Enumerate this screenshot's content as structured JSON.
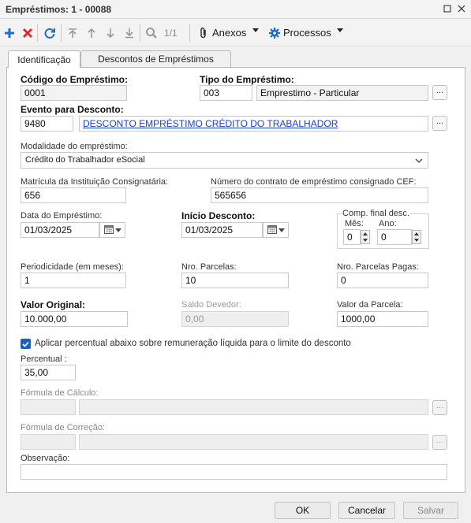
{
  "window": {
    "title": "Empréstimos: 1 - 00088"
  },
  "toolbar": {
    "pager": "1/1",
    "attachments_label": "Anexos",
    "processes_label": "Processos"
  },
  "tabs": [
    {
      "label": "Identificação",
      "active": true
    },
    {
      "label": "Descontos de Empréstimos",
      "active": false
    }
  ],
  "form": {
    "codigo": {
      "label": "Código do Empréstimo:",
      "value": "0001"
    },
    "tipo": {
      "label": "Tipo do Empréstimo:",
      "code": "003",
      "desc": "Emprestimo - Particular"
    },
    "evento": {
      "label": "Evento para Desconto:",
      "code": "9480",
      "desc": "DESCONTO EMPRÉSTIMO CRÉDITO DO TRABALHADOR"
    },
    "modalidade": {
      "label": "Modalidade do empréstimo:",
      "value": "Crédito do Trabalhador eSocial"
    },
    "matricula": {
      "label": "Matrícula da Instituição Consignatária:",
      "value": "656"
    },
    "contrato": {
      "label": "Número do contrato de empréstimo consignado CEF:",
      "value": "565656"
    },
    "data_emprestimo": {
      "label": "Data do Empréstimo:",
      "value": "01/03/2025"
    },
    "inicio_desconto": {
      "label": "Início Desconto:",
      "value": "01/03/2025"
    },
    "comp_final": {
      "label": "Comp. final desc.",
      "mes_label": "Mês:",
      "mes_value": "0",
      "ano_label": "Ano:",
      "ano_value": "0"
    },
    "periodicidade": {
      "label": "Periodicidade (em meses):",
      "value": "1"
    },
    "nro_parcelas": {
      "label": "Nro. Parcelas:",
      "value": "10"
    },
    "parcelas_pagas": {
      "label": "Nro. Parcelas Pagas:",
      "value": "0"
    },
    "valor_original": {
      "label": "Valor Original:",
      "value": "10.000,00"
    },
    "saldo_devedor": {
      "label": "Saldo Devedor:",
      "value": "0,00"
    },
    "valor_parcela": {
      "label": "Valor da Parcela:",
      "value": "1000,00"
    },
    "aplicar_percentual": {
      "label": "Aplicar percentual abaixo sobre remuneração líquida para o limite do desconto",
      "checked": true
    },
    "percentual": {
      "label": "Percentual :",
      "value": "35,00"
    },
    "formula_calculo": {
      "label": "Fórmula de Cálculo:",
      "value": ""
    },
    "formula_correcao": {
      "label": "Fórmula de Correção:",
      "value": ""
    },
    "observacao": {
      "label": "Observação:",
      "value": ""
    },
    "lookup_button": "..."
  },
  "footer": {
    "ok": "OK",
    "cancel": "Cancelar",
    "save": "Salvar"
  },
  "colors": {
    "accent": "#1e62b5",
    "add": "#1f6fc4",
    "delete": "#d62b2b",
    "link": "#1a3fcc"
  }
}
